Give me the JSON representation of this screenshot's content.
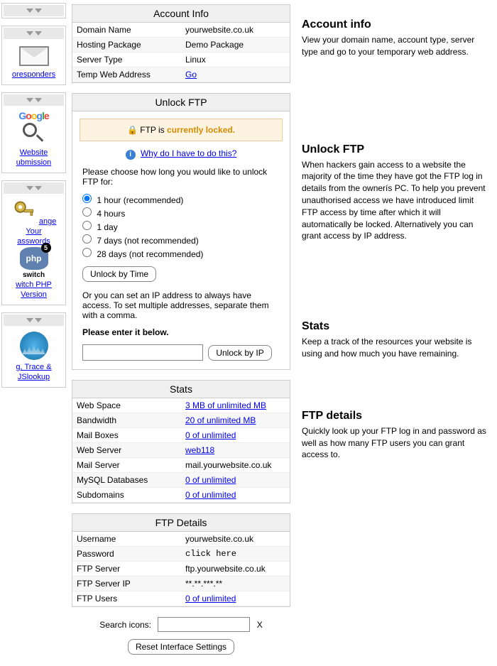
{
  "sidebar": {
    "autoresponders": "oresponders",
    "website_submission_l1": "Website",
    "website_submission_l2": "ubmission",
    "change_l1": "ange Your",
    "change_l2": "asswords",
    "switch_label": "switch",
    "switch_php_l1": "witch PHP",
    "switch_php_l2": "Version",
    "trace_l1": "g, Trace &",
    "trace_l2": "JSlookup"
  },
  "account_info": {
    "header": "Account Info",
    "rows": [
      {
        "label": "Domain Name",
        "value": "yourwebsite.co.uk",
        "link": false
      },
      {
        "label": "Hosting Package",
        "value": "Demo Package",
        "link": false
      },
      {
        "label": "Server Type",
        "value": "Linux",
        "link": false
      },
      {
        "label": "Temp Web Address",
        "value": "Go",
        "link": true
      }
    ]
  },
  "unlock_ftp": {
    "header": "Unlock FTP",
    "locked_prefix": "FTP is ",
    "locked_bold": "currently locked.",
    "why_link": "Why do I have to do this?",
    "choose_text": "Please choose how long you would like to unlock FTP for:",
    "options": [
      "1 hour (recommended)",
      "4 hours",
      "1 day",
      "7 days (not recommended)",
      "28 days (not recommended)"
    ],
    "unlock_time_btn": "Unlock by Time",
    "ip_text": "Or you can set an IP address to always have access. To set multiple addresses, separate them with a comma.",
    "enter_below": "Please enter it below.",
    "unlock_ip_btn": "Unlock by IP"
  },
  "stats": {
    "header": "Stats",
    "rows": [
      {
        "label": "Web Space",
        "value": "3 MB of unlimited MB",
        "link": true
      },
      {
        "label": "Bandwidth",
        "value": "20 of unlimited MB",
        "link": true
      },
      {
        "label": "Mail Boxes",
        "value": "0 of unlimited",
        "link": true
      },
      {
        "label": "Web Server",
        "value": "web118",
        "link": true
      },
      {
        "label": "Mail Server",
        "value": "mail.yourwebsite.co.uk",
        "link": false
      },
      {
        "label": "MySQL Databases",
        "value": "0 of unlimited",
        "link": true
      },
      {
        "label": "Subdomains",
        "value": "0 of unlimited",
        "link": true
      }
    ]
  },
  "ftp_details": {
    "header": "FTP Details",
    "rows": [
      {
        "label": "Username",
        "value": "yourwebsite.co.uk",
        "link": false,
        "mono": false
      },
      {
        "label": "Password",
        "value": "click here",
        "link": false,
        "mono": true
      },
      {
        "label": "FTP Server",
        "value": "ftp.yourwebsite.co.uk",
        "link": false,
        "mono": false
      },
      {
        "label": "FTP Server IP",
        "value": "**.**.***.**",
        "link": false,
        "mono": false
      },
      {
        "label": "FTP Users",
        "value": "0 of unlimited",
        "link": true,
        "mono": false
      }
    ]
  },
  "search": {
    "label": "Search icons:",
    "x": "X",
    "reset_btn": "Reset Interface Settings"
  },
  "annotations": {
    "account": {
      "title": "Account info",
      "body": "View your domain name, account type, server type and go to your temporary web address."
    },
    "ftp": {
      "title": "Unlock FTP",
      "body": "When hackers gain access to a website the majority of the time they have got the FTP log in details from the ownerís PC. To help you prevent unauthorised access we have introduced limit FTP access by time after which it will automatically be locked. Alternatively you can grant access by IP address."
    },
    "stats": {
      "title": "Stats",
      "body": "Keep a track of the resources your website is using and how much you have remaining."
    },
    "ftpd": {
      "title": "FTP details",
      "body": "Quickly look up your FTP log in and password as well as how many FTP users you can grant access to."
    }
  }
}
